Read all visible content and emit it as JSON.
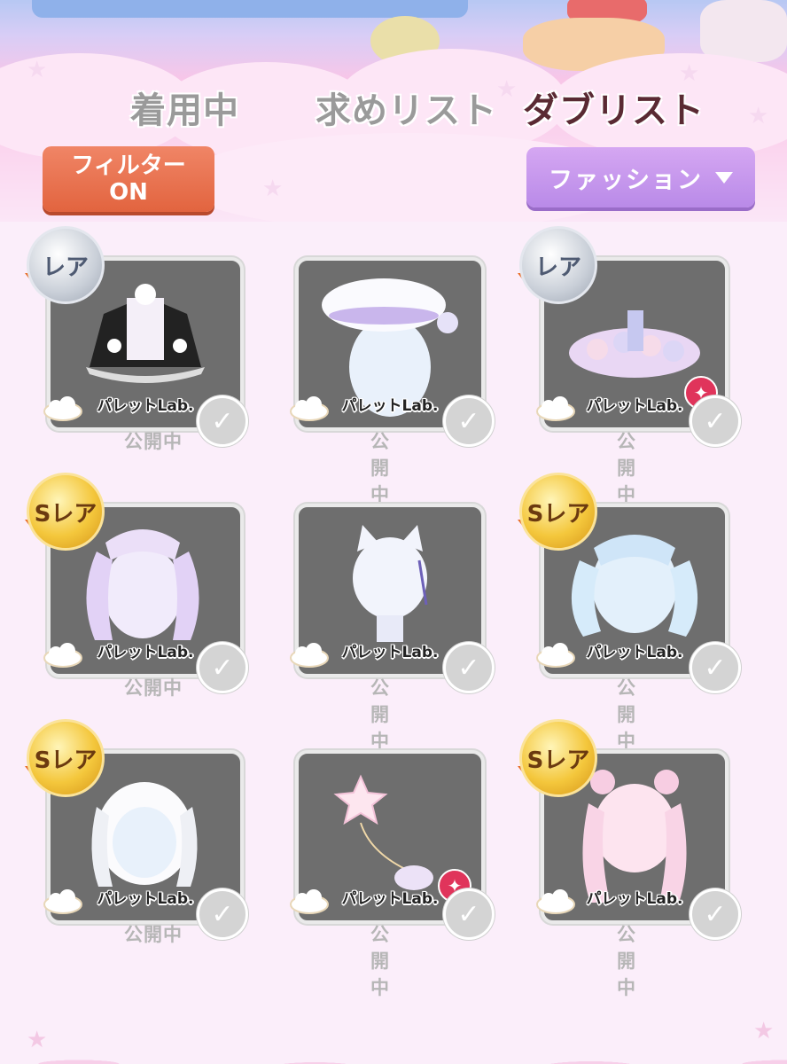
{
  "tabs": {
    "wearing": "着用中",
    "wishlist": "求めリスト",
    "duplicates": "ダブリスト"
  },
  "filter_button": {
    "line1": "フィルター",
    "line2": "ON"
  },
  "category_dropdown": {
    "selected": "ファッション"
  },
  "items": [
    {
      "rarity": "レア",
      "maker": "パレットLab.",
      "status": "公開中",
      "new_mark": false,
      "art": "outfit-dress-icon"
    },
    {
      "rarity": "",
      "maker": "パレットLab.",
      "status": "公開中",
      "new_mark": false,
      "art": "hat-icon"
    },
    {
      "rarity": "レア",
      "maker": "パレットLab.",
      "status": "公開中",
      "new_mark": true,
      "art": "flower-skirt-icon"
    },
    {
      "rarity": "Sレア",
      "maker": "パレットLab.",
      "status": "公開中",
      "new_mark": false,
      "art": "twintail-hair-icon"
    },
    {
      "rarity": "",
      "maker": "パレットLab.",
      "status": "公開中",
      "new_mark": false,
      "art": "cat-ear-outfit-icon"
    },
    {
      "rarity": "Sレア",
      "maker": "パレットLab.",
      "status": "公開中",
      "new_mark": false,
      "art": "wavy-hair-icon"
    },
    {
      "rarity": "Sレア",
      "maker": "パレットLab.",
      "status": "公開中",
      "new_mark": false,
      "art": "braid-hair-icon"
    },
    {
      "rarity": "",
      "maker": "パレットLab.",
      "status": "公開中",
      "new_mark": true,
      "art": "star-balloon-icon"
    },
    {
      "rarity": "Sレア",
      "maker": "パレットLab.",
      "status": "公開中",
      "new_mark": false,
      "art": "pink-long-hair-icon"
    }
  ],
  "colors": {
    "filter": "#e2643f",
    "dropdown": "#b98ae8",
    "active_tab": "#5a2a33",
    "inactive_tab": "#9a9a9a",
    "item_bg": "#6e6e6e"
  }
}
